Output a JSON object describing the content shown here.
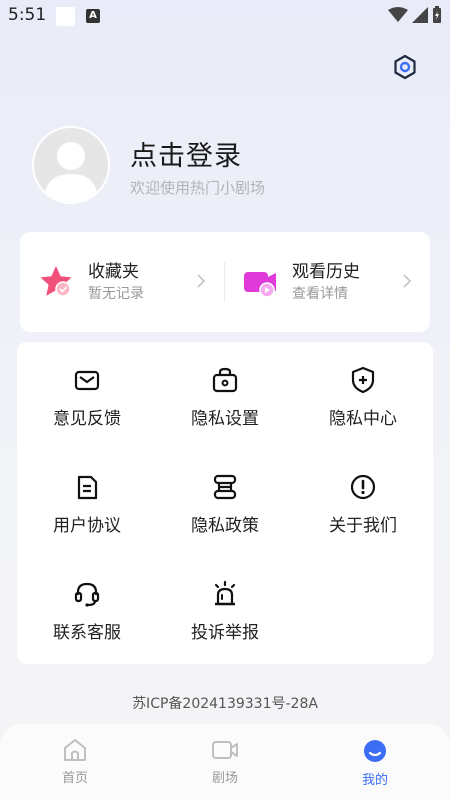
{
  "status_bar": {
    "time": "5:51",
    "notification_icon": "A"
  },
  "header": {
    "settings_icon": "settings-hexagon-icon"
  },
  "profile": {
    "avatar_icon": "default-avatar-icon",
    "login_title": "点击登录",
    "welcome_text": "欢迎使用热门小剧场"
  },
  "quick_cards": [
    {
      "title": "收藏夹",
      "subtitle": "暂无记录",
      "icon": "star-favorite-icon"
    },
    {
      "title": "观看历史",
      "subtitle": "查看详情",
      "icon": "video-history-icon"
    }
  ],
  "menu": [
    {
      "label": "意见反馈",
      "icon": "mail-icon"
    },
    {
      "label": "隐私设置",
      "icon": "lock-bag-icon"
    },
    {
      "label": "隐私中心",
      "icon": "shield-plus-icon"
    },
    {
      "label": "用户协议",
      "icon": "document-icon"
    },
    {
      "label": "隐私政策",
      "icon": "policy-stack-icon"
    },
    {
      "label": "关于我们",
      "icon": "info-exclamation-icon"
    },
    {
      "label": "联系客服",
      "icon": "headset-icon"
    },
    {
      "label": "投诉举报",
      "icon": "alarm-siren-icon"
    }
  ],
  "icp": "苏ICP备2024139331号-28A",
  "tabs": [
    {
      "label": "首页",
      "icon": "home-icon",
      "active": false
    },
    {
      "label": "剧场",
      "icon": "video-camera-icon",
      "active": false
    },
    {
      "label": "我的",
      "icon": "profile-mascot-icon",
      "active": true
    }
  ],
  "colors": {
    "accent": "#3b6ef5",
    "favorite_pink": "#f0507a",
    "history_magenta": "#e03ad8"
  }
}
